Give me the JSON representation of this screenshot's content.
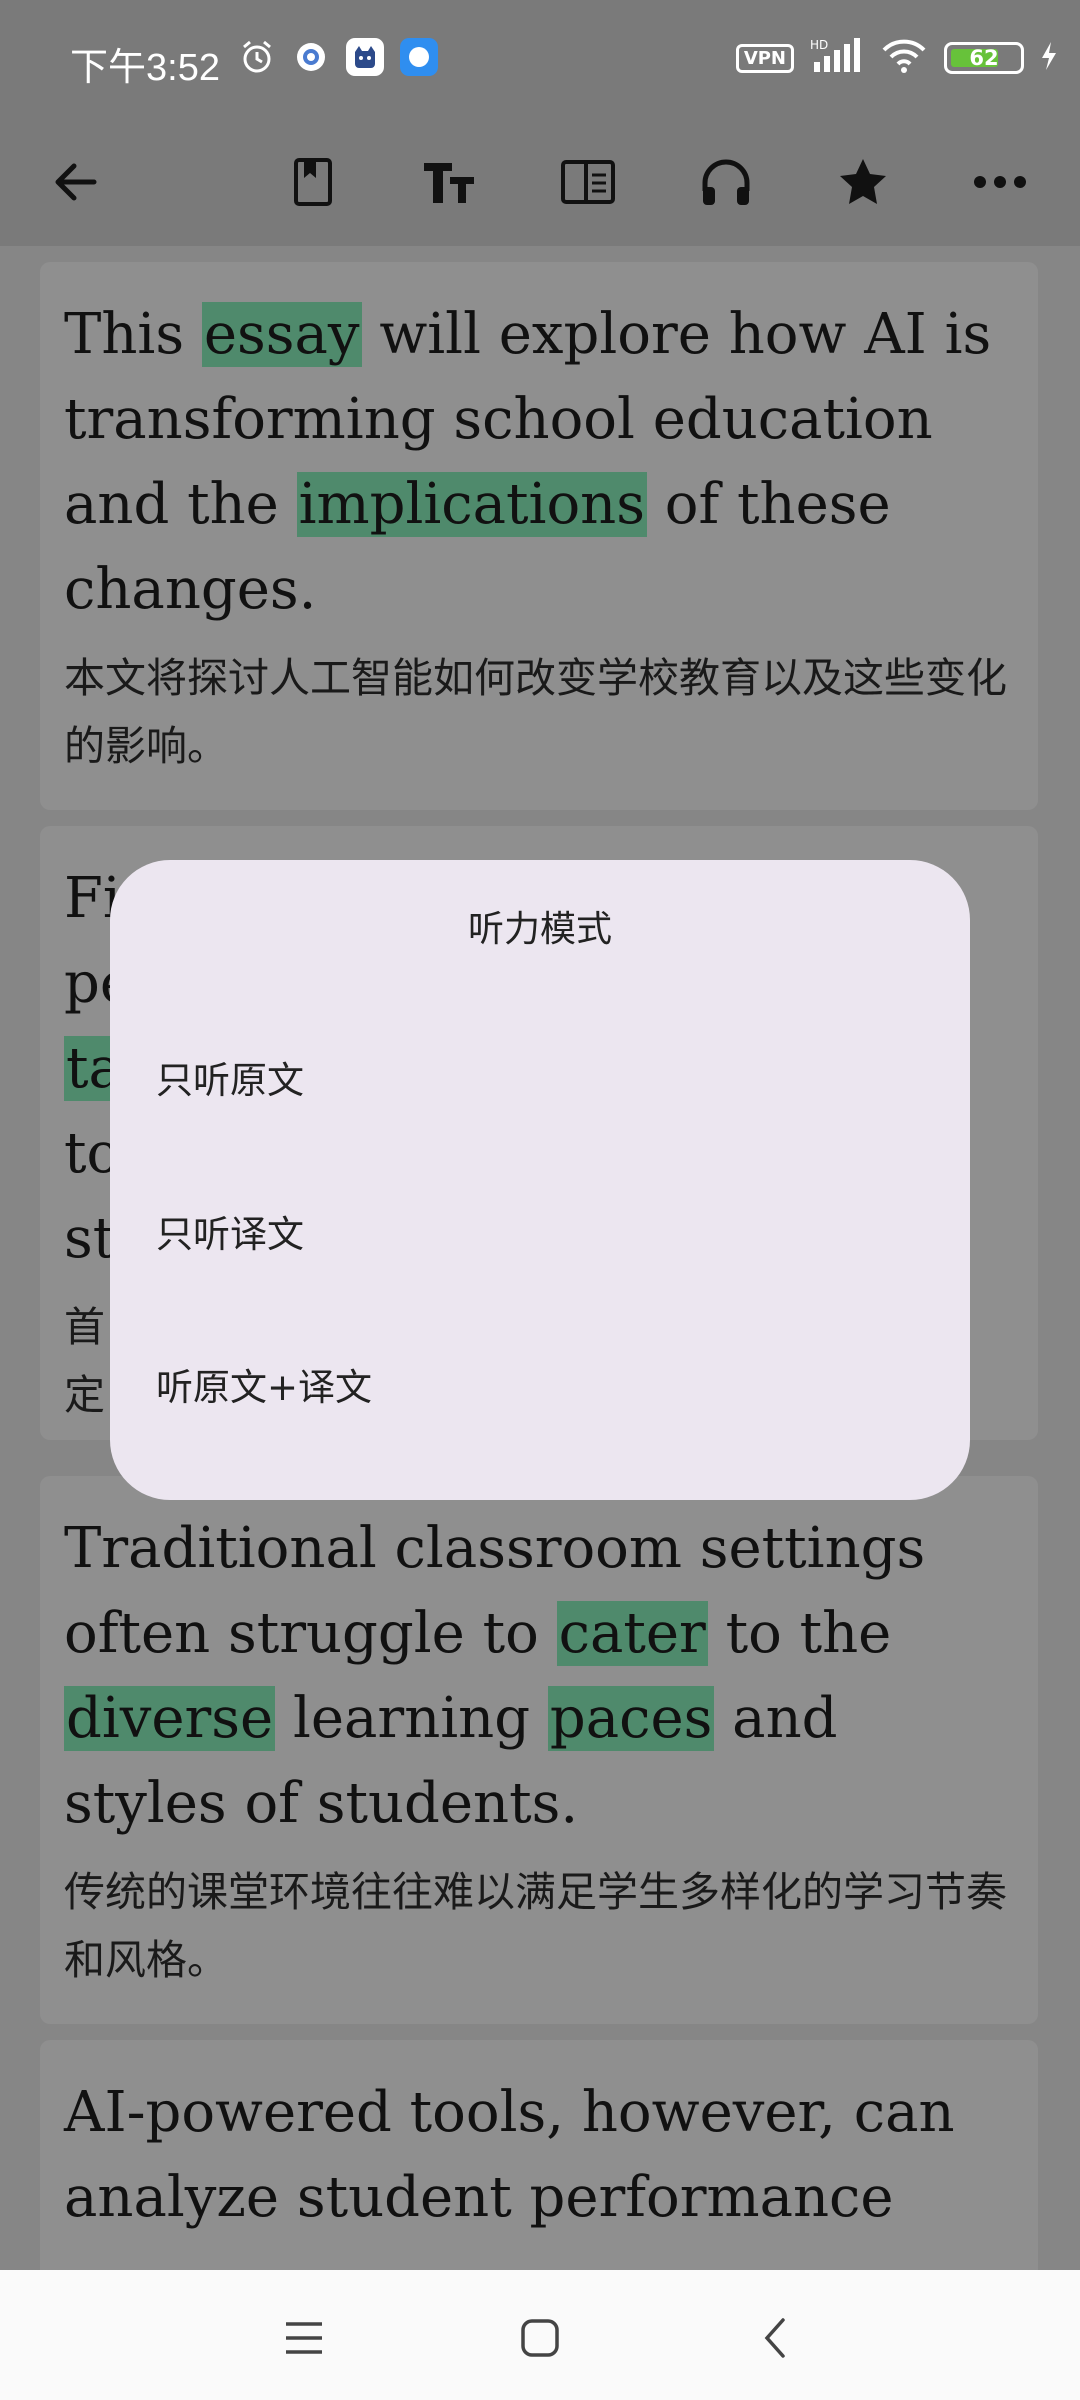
{
  "status": {
    "time": "下午3:52",
    "vpn": "VPN",
    "hd": "HD",
    "battery": "62"
  },
  "toolbar": {
    "icons": [
      "back-arrow-icon",
      "bookmark-icon",
      "text-size-icon",
      "layout-icon",
      "headphones-icon",
      "star-icon",
      "more-icon"
    ]
  },
  "cards": [
    {
      "en_segments": [
        {
          "t": "This "
        },
        {
          "t": "essay",
          "hl": "green"
        },
        {
          "t": " will explore how AI is transforming school education and the "
        },
        {
          "t": "implications",
          "hl": "green"
        },
        {
          "t": " of these changes."
        }
      ],
      "zh": "本文将探讨人工智能如何改变学校教育以及这些变化的影响。"
    },
    {
      "en_lines": [
        "Fi",
        "pe",
        "ta",
        "to",
        "st"
      ],
      "zh_lines": [
        "首",
        "定"
      ]
    },
    {
      "en_segments": [
        {
          "t": "Traditional classroom settings often struggle to "
        },
        {
          "t": "cater",
          "hl": "green"
        },
        {
          "t": " to the "
        },
        {
          "t": "diverse",
          "hl": "green"
        },
        {
          "t": " learning "
        },
        {
          "t": "paces",
          "hl": "green"
        },
        {
          "t": " and styles of students."
        }
      ],
      "zh": "传统的课堂环境往往难以满足学生多样化的学习节奏和风格。"
    },
    {
      "en_text": "AI-powered tools, however, can analyze student performance"
    }
  ],
  "dialog": {
    "title": "听力模式",
    "options": [
      "只听原文",
      "只听译文",
      "听原文+译文"
    ]
  },
  "colors": {
    "highlight_green": "#4f8a6c",
    "dialog_bg": "#ece6f0"
  }
}
